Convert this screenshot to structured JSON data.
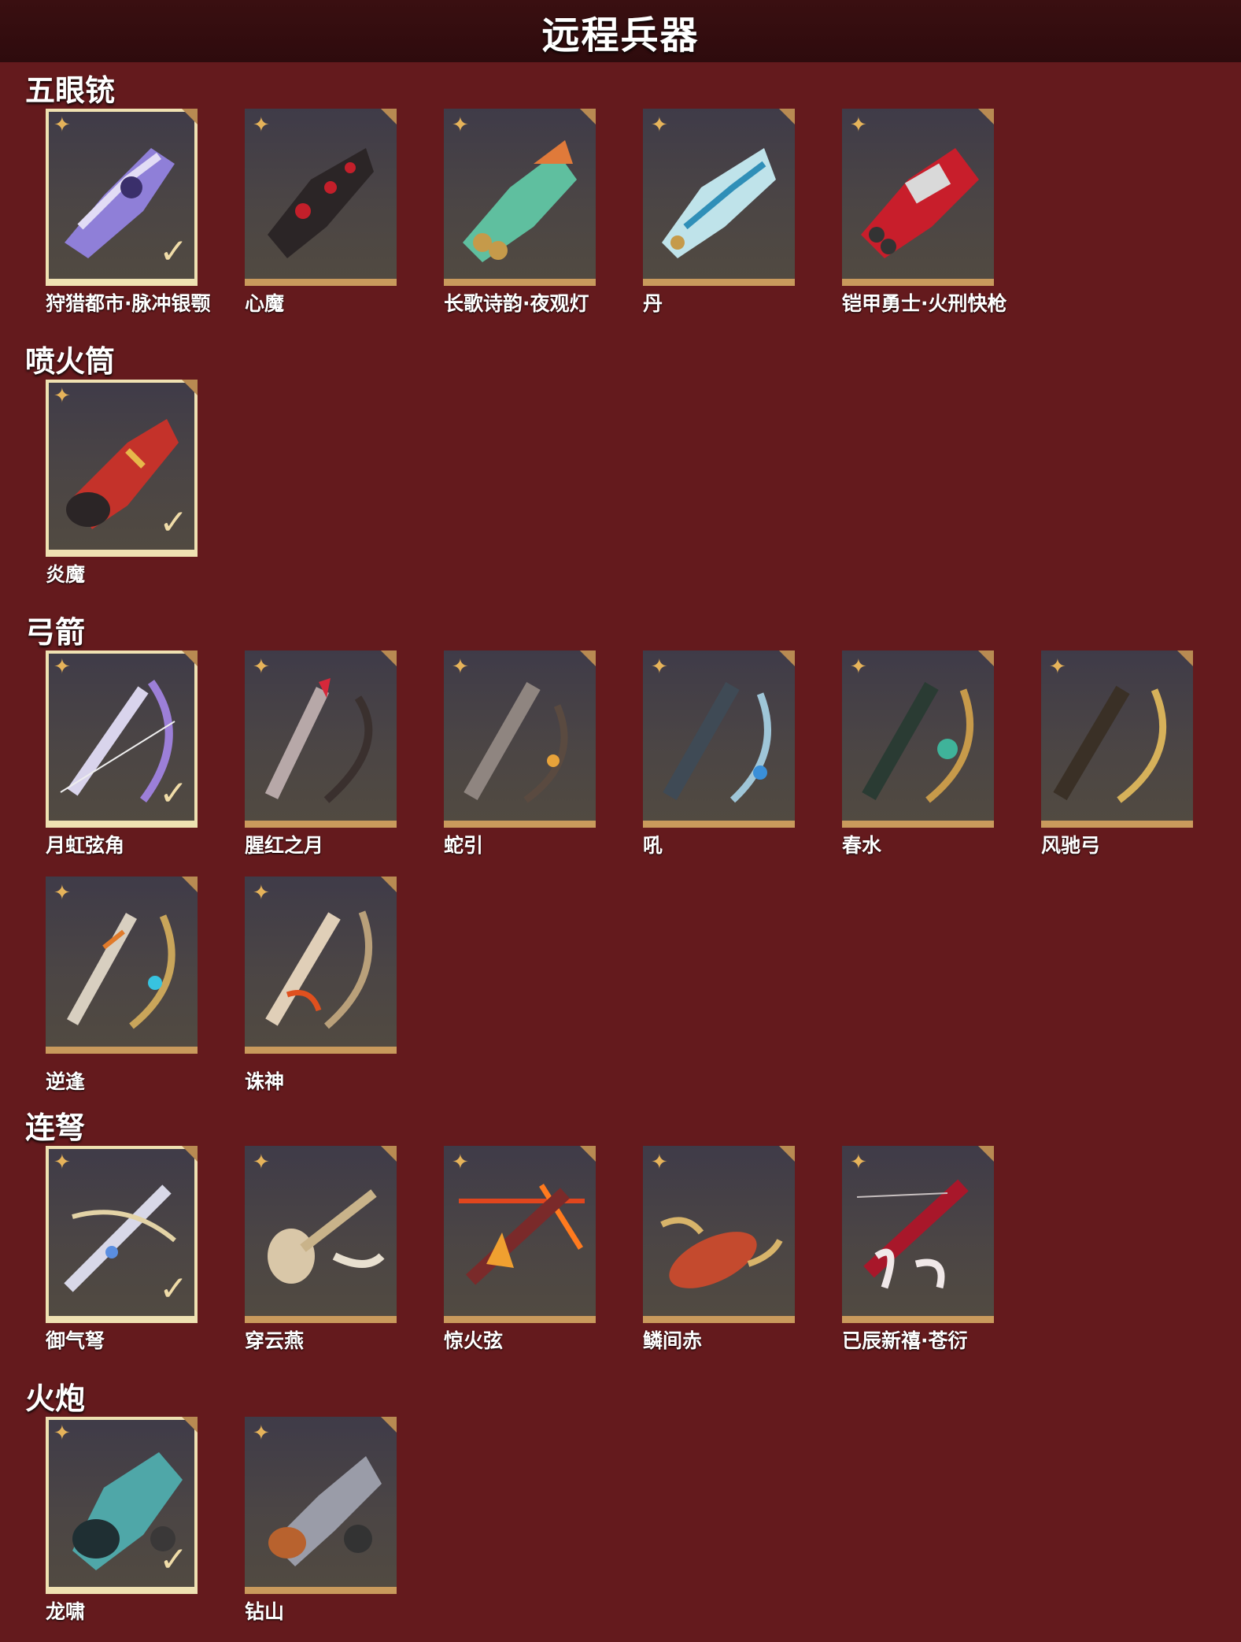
{
  "header": {
    "title": "远程兵器"
  },
  "sections": [
    {
      "title": "五眼铳",
      "items": [
        "狩猎都市·脉冲银颚",
        "心魔",
        "长歌诗韵·夜观灯",
        "丹",
        "铠甲勇士·火刑快枪"
      ]
    },
    {
      "title": "喷火筒",
      "items": [
        "炎魔"
      ]
    },
    {
      "title": "弓箭",
      "items": [
        "月虹弦角",
        "腥红之月",
        "蛇引",
        "吼",
        "春水",
        "风驰弓",
        "逆逢",
        "诛神"
      ]
    },
    {
      "title": "连弩",
      "items": [
        "御气弩",
        "穿云燕",
        "惊火弦",
        "鳞间赤",
        "已辰新禧·苍衍"
      ]
    },
    {
      "title": "火炮",
      "items": [
        "龙啸",
        "钻山"
      ]
    }
  ],
  "icons": {
    "rarity": "four-point-star-icon",
    "equipped": "checkmark-icon"
  },
  "colors": {
    "background": "#641a1d",
    "header": "#2e0b0d",
    "frame": "#c99a5c",
    "selected": "#efe1b2"
  }
}
